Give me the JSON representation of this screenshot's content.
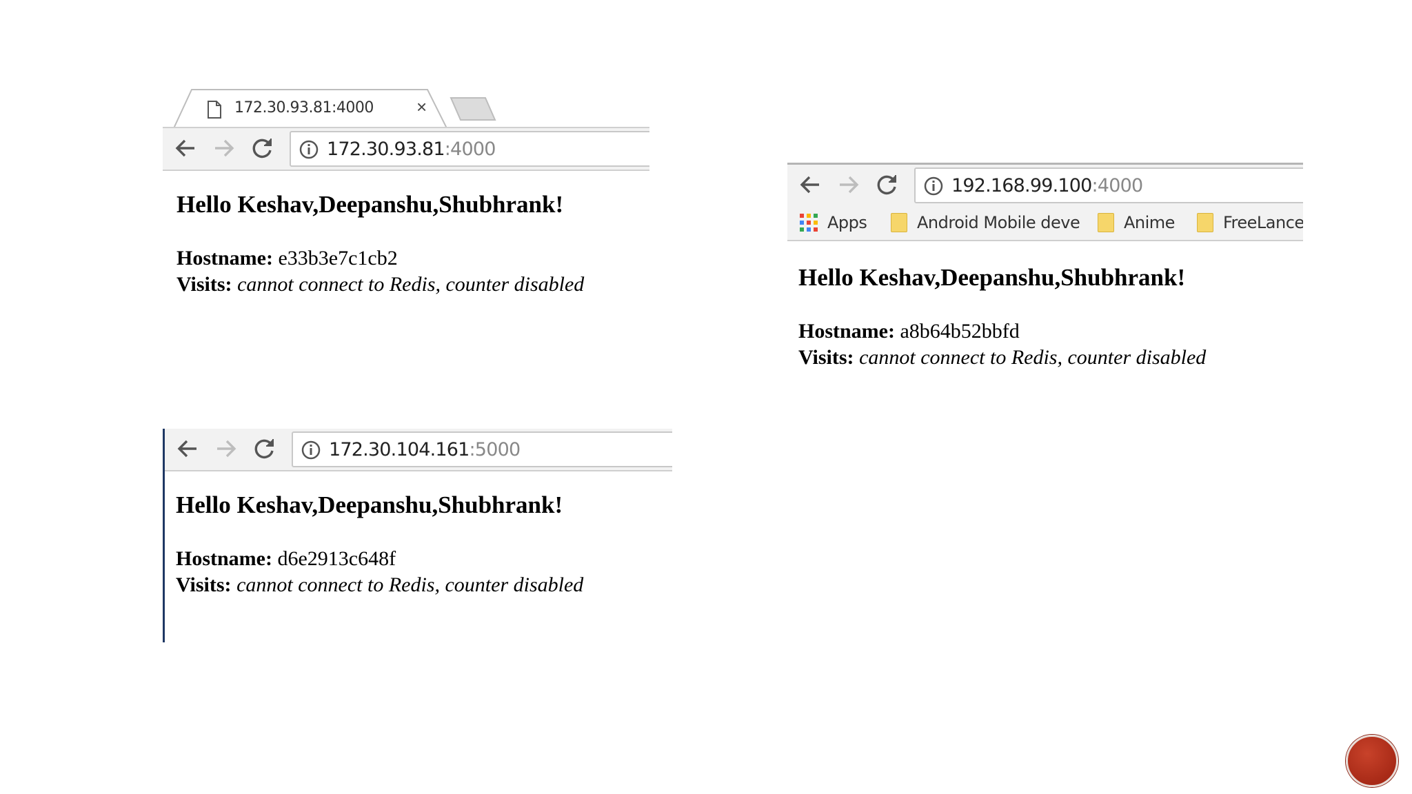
{
  "windows": [
    {
      "tab": {
        "title": "172.30.93.81:4000",
        "close_glyph": "×"
      },
      "toolbar": {
        "url_host": "172.30.93.81",
        "url_port": ":4000"
      },
      "page": {
        "heading": "Hello Keshav,Deepanshu,Shubhrank!",
        "hostname_label": "Hostname:",
        "hostname_value": "e33b3e7c1cb2",
        "visits_label": "Visits:",
        "visits_value": "cannot connect to Redis, counter disabled"
      }
    },
    {
      "toolbar": {
        "url_host": "192.168.99.100",
        "url_port": ":4000"
      },
      "bookmarks": [
        {
          "label": "Apps",
          "icon": "apps-grid-icon"
        },
        {
          "label": "Android Mobile deve",
          "icon": "folder-icon"
        },
        {
          "label": "Anime",
          "icon": "folder-icon"
        },
        {
          "label": "FreeLance",
          "icon": "folder-icon"
        }
      ],
      "page": {
        "heading": "Hello Keshav,Deepanshu,Shubhrank!",
        "hostname_label": "Hostname:",
        "hostname_value": "a8b64b52bbfd",
        "visits_label": "Visits:",
        "visits_value": "cannot connect to Redis, counter disabled"
      }
    },
    {
      "toolbar": {
        "url_host": "172.30.104.161",
        "url_port": ":5000"
      },
      "page": {
        "heading": "Hello Keshav,Deepanshu,Shubhrank!",
        "hostname_label": "Hostname:",
        "hostname_value": "d6e2913c648f",
        "visits_label": "Visits:",
        "visits_value": "cannot connect to Redis, counter disabled"
      }
    }
  ],
  "colors": {
    "accent_badge": "#b5331f",
    "side_border": "#1f3864",
    "apps_grid": [
      "#ea4335",
      "#fbbc05",
      "#34a853",
      "#4285f4"
    ]
  }
}
